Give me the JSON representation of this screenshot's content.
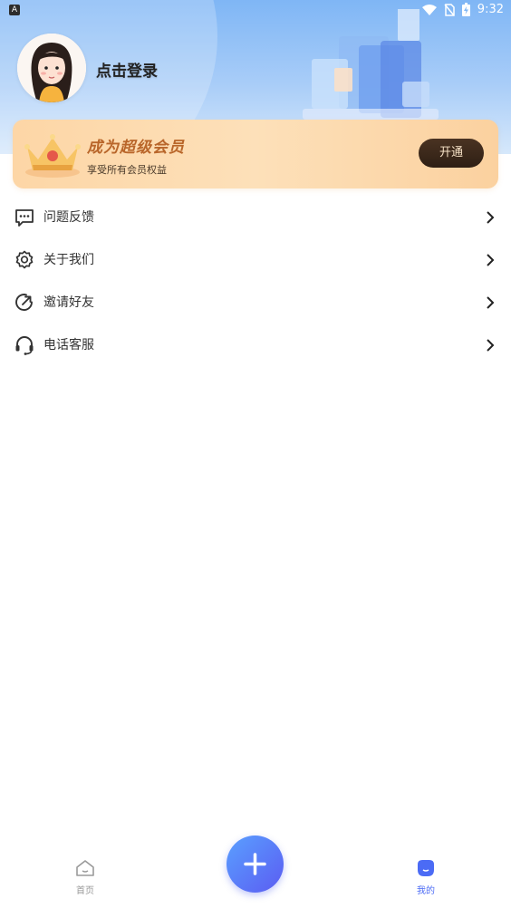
{
  "status_bar": {
    "left_indicator": "A",
    "time": "9:32",
    "icons": [
      "wifi-icon",
      "no-sim-icon",
      "battery-icon"
    ]
  },
  "profile": {
    "login_text": "点击登录",
    "avatar_icon": "avatar-girl"
  },
  "vip_card": {
    "title": "成为超级会员",
    "subtitle": "享受所有会员权益",
    "button_label": "开通"
  },
  "menu": {
    "items": [
      {
        "label": "问题反馈",
        "icon": "feedback-chat-icon"
      },
      {
        "label": "关于我们",
        "icon": "gear-icon"
      },
      {
        "label": "邀请好友",
        "icon": "share-arrow-icon"
      },
      {
        "label": "电话客服",
        "icon": "headset-icon"
      }
    ]
  },
  "bottom_nav": {
    "home_label": "首页",
    "mine_label": "我的",
    "active_tab": "mine"
  },
  "colors": {
    "accent": "#4b6bf5",
    "vip_title": "#b9662a",
    "vip_button_bg": "#3a281a"
  }
}
